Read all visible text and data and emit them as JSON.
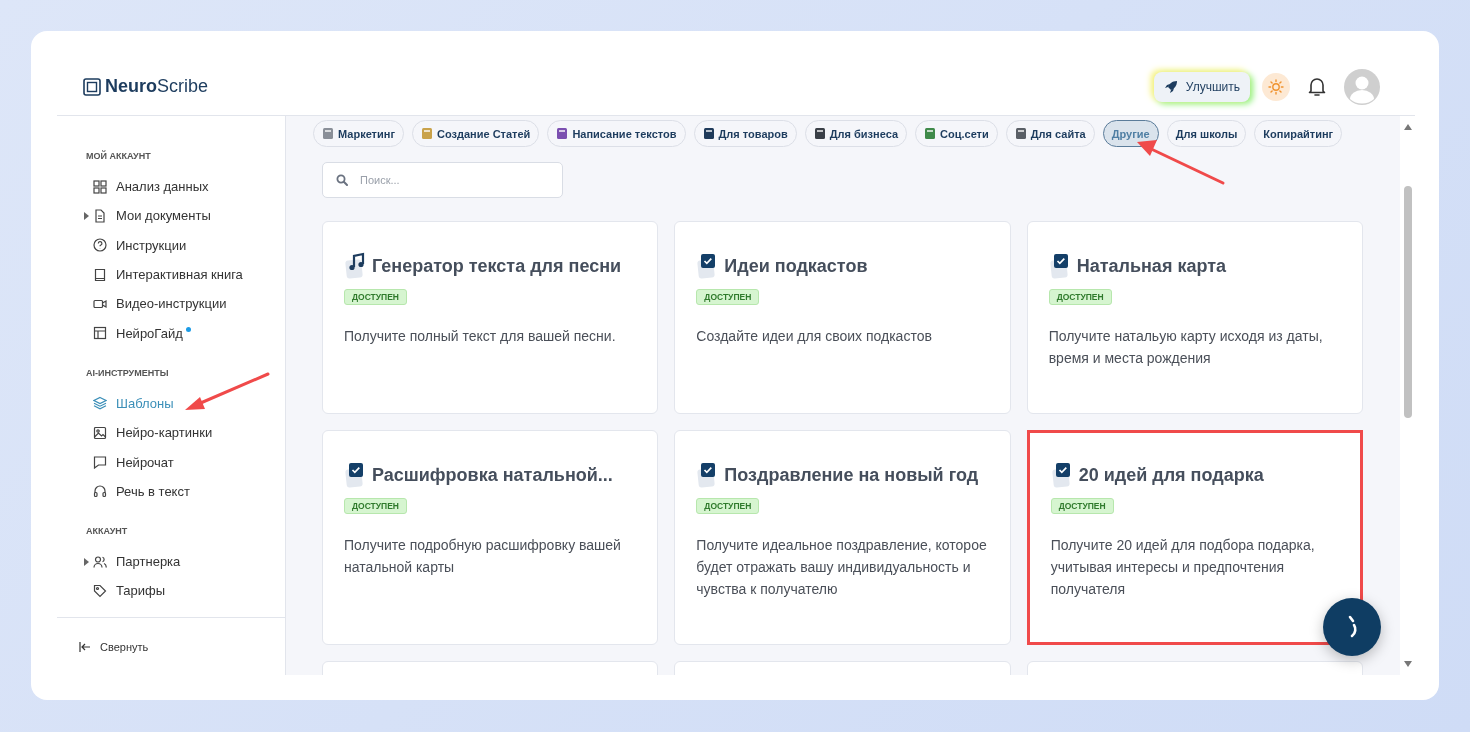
{
  "logo": {
    "bold": "Neuro",
    "light": "Scribe"
  },
  "header": {
    "upgrade_button": "Улучшить"
  },
  "sidebar": {
    "sections": [
      {
        "title": "МОЙ АККАУНТ",
        "items": [
          {
            "label": "Анализ данных",
            "kind": "grid",
            "selected": false
          },
          {
            "label": "Мои документы",
            "kind": "doc",
            "selected": false,
            "expanded": false
          },
          {
            "label": "Инструкции",
            "kind": "help",
            "selected": false
          },
          {
            "label": "Интерактивная книга",
            "kind": "book",
            "selected": false
          },
          {
            "label": "Видео-инструкции",
            "kind": "video",
            "selected": false
          },
          {
            "label": "НейроГайд",
            "kind": "layout",
            "selected": false,
            "notification": true
          }
        ]
      },
      {
        "title": "AI-ИНСТРУМЕНТЫ",
        "items": [
          {
            "label": "Шаблоны",
            "kind": "layers",
            "selected": true
          },
          {
            "label": "Нейро-картинки",
            "kind": "image",
            "selected": false
          },
          {
            "label": "Нейрочат",
            "kind": "chat",
            "selected": false
          },
          {
            "label": "Речь в текст",
            "kind": "headphones",
            "selected": false
          }
        ]
      },
      {
        "title": "АККАУНТ",
        "items": [
          {
            "label": "Партнерка",
            "kind": "users",
            "selected": false,
            "expanded": false
          },
          {
            "label": "Тарифы",
            "kind": "tag",
            "selected": false
          }
        ]
      }
    ],
    "collapse": "Свернуть"
  },
  "categories": [
    {
      "label": "Маркетинг",
      "kind": "emoji",
      "selected": false
    },
    {
      "label": "Создание Статей",
      "kind": "emoji",
      "selected": false
    },
    {
      "label": "Написание текстов",
      "kind": "emoji",
      "selected": false
    },
    {
      "label": "Для товаров",
      "kind": "emoji",
      "selected": false
    },
    {
      "label": "Для бизнеса",
      "kind": "emoji",
      "selected": false
    },
    {
      "label": "Соц.сети",
      "kind": "emoji",
      "selected": false
    },
    {
      "label": "Для сайта",
      "kind": "emoji",
      "selected": false
    },
    {
      "label": "Другие",
      "kind": "plain",
      "selected": true
    },
    {
      "label": "Для школы",
      "kind": "plain",
      "selected": false
    },
    {
      "label": "Копирайтинг",
      "kind": "plain",
      "selected": false
    }
  ],
  "search": {
    "placeholder": "Поиск..."
  },
  "cards": [
    {
      "title": "Генератор текста для песни",
      "kind": "music",
      "badge": "ДОСТУПЕН",
      "description": "Получите полный текст для вашей песни.",
      "highlighted": false
    },
    {
      "title": "Идеи подкастов",
      "kind": "check",
      "badge": "ДОСТУПЕН",
      "description": "Создайте идеи для своих подкастов",
      "highlighted": false
    },
    {
      "title": "Натальная карта",
      "kind": "check",
      "badge": "ДОСТУПЕН",
      "description": "Получите натальую карту исходя из даты, время и места рождения",
      "highlighted": false
    },
    {
      "title": "Расшифровка натальной...",
      "kind": "check",
      "badge": "ДОСТУПЕН",
      "description": "Получите подробную расшифровку вашей натальной карты",
      "highlighted": false
    },
    {
      "title": "Поздравление на новый год",
      "kind": "check",
      "badge": "ДОСТУПЕН",
      "description": "Получите идеальное поздравление, которое будет отражать вашу индивидуальность и чувства к получателю",
      "highlighted": false
    },
    {
      "title": "20 идей для подарка",
      "kind": "check",
      "badge": "ДОСТУПЕН",
      "description": "Получите 20 идей для подбора подарка, учитывая интересы и предпочтения получателя",
      "highlighted": true
    }
  ]
}
